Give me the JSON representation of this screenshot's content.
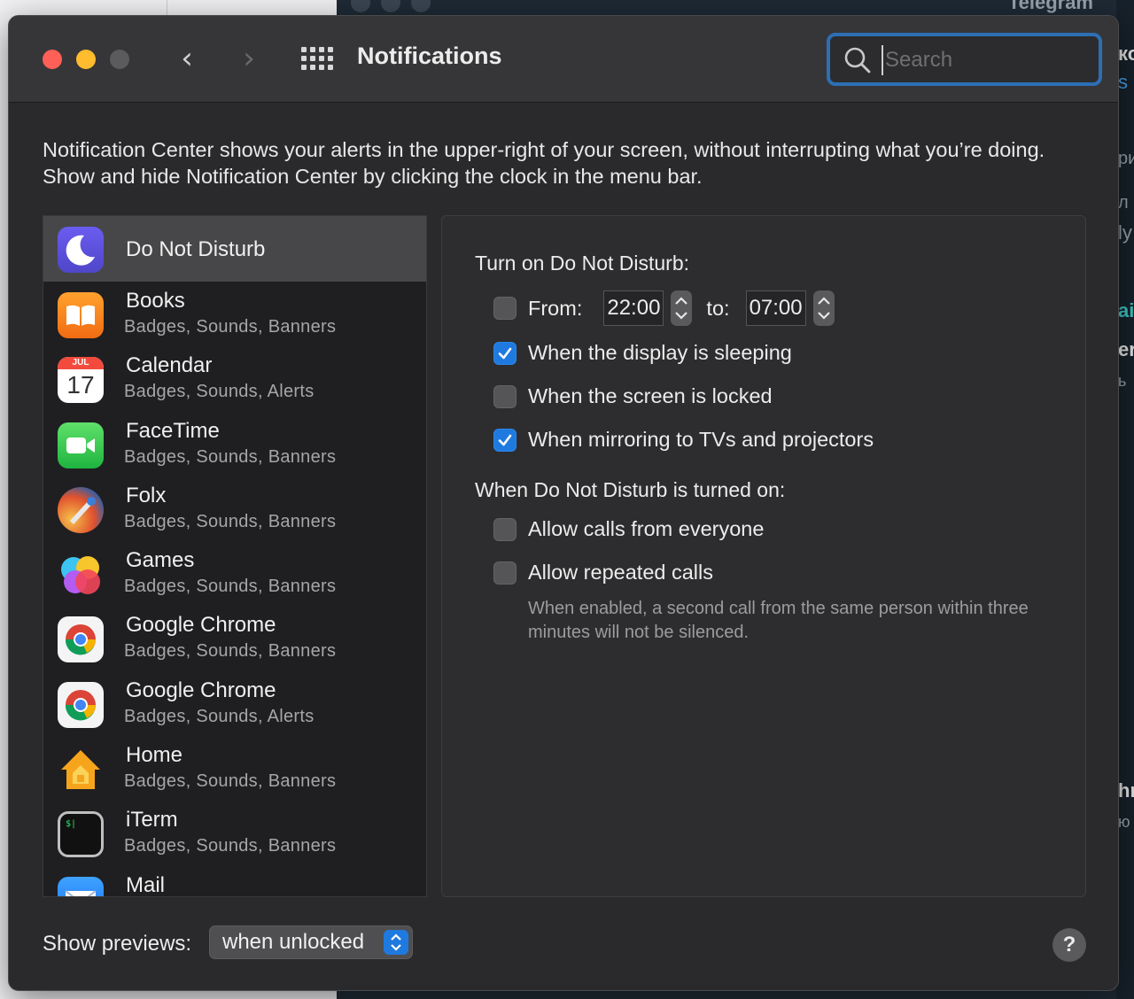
{
  "background": {
    "right_app_title": "Telegram",
    "edge_fragments": [
      "ко",
      "s",
      "ри",
      "л",
      "ly",
      "ail",
      "er",
      "ь",
      "hr",
      "ю"
    ]
  },
  "window": {
    "title": "Notifications",
    "search": {
      "placeholder": "Search",
      "value": ""
    },
    "nav": {
      "back": "‹",
      "forward": "›"
    }
  },
  "intro": "Notification Center shows your alerts in the upper-right of your screen, without interrupting what you’re doing. Show and hide Notification Center by clicking the clock in the menu bar.",
  "app_list": [
    {
      "name": "Do Not Disturb",
      "sub": "",
      "icon": "moon-icon",
      "selected": true
    },
    {
      "name": "Books",
      "sub": "Badges, Sounds, Banners",
      "icon": "books-icon"
    },
    {
      "name": "Calendar",
      "sub": "Badges, Sounds, Alerts",
      "icon": "calendar-icon",
      "month": "JUL",
      "day": "17"
    },
    {
      "name": "FaceTime",
      "sub": "Badges, Sounds, Banners",
      "icon": "facetime-icon"
    },
    {
      "name": "Folx",
      "sub": "Badges, Sounds, Banners",
      "icon": "folx-icon"
    },
    {
      "name": "Games",
      "sub": "Badges, Sounds, Banners",
      "icon": "games-icon"
    },
    {
      "name": "Google Chrome",
      "sub": "Badges, Sounds, Banners",
      "icon": "chrome-icon"
    },
    {
      "name": "Google Chrome",
      "sub": "Badges, Sounds, Alerts",
      "icon": "chrome-icon"
    },
    {
      "name": "Home",
      "sub": "Badges, Sounds, Banners",
      "icon": "home-icon"
    },
    {
      "name": "iTerm",
      "sub": "Badges, Sounds, Banners",
      "icon": "iterm-icon"
    },
    {
      "name": "Mail",
      "sub": "",
      "icon": "mail-icon"
    }
  ],
  "dnd": {
    "turn_on_heading": "Turn on Do Not Disturb:",
    "from_label": "From:",
    "from_time": "22:00",
    "to_label": "to:",
    "to_time": "07:00",
    "from_checked": false,
    "options": [
      {
        "label": "When the display is sleeping",
        "checked": true
      },
      {
        "label": "When the screen is locked",
        "checked": false
      },
      {
        "label": "When mirroring to TVs and projectors",
        "checked": true
      }
    ],
    "when_on_heading": "When Do Not Disturb is turned on:",
    "when_on_options": [
      {
        "label": "Allow calls from everyone",
        "checked": false
      },
      {
        "label": "Allow repeated calls",
        "checked": false
      }
    ],
    "hint": "When enabled, a second call from the same person within three minutes will not be silenced."
  },
  "footer": {
    "show_previews_label": "Show previews:",
    "show_previews_value": "when unlocked",
    "help": "?"
  },
  "colors": {
    "accent": "#1f7ae0",
    "close": "#fe5f57",
    "minimize": "#febc2e"
  }
}
